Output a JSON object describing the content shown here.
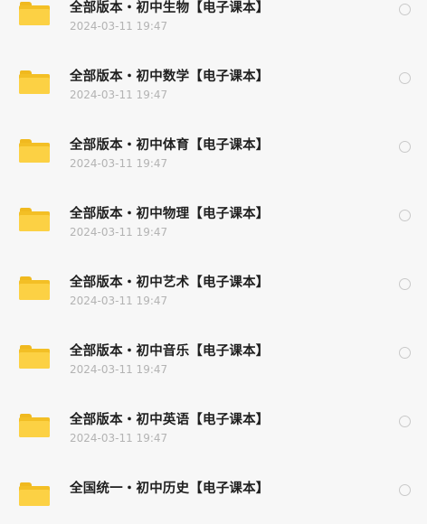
{
  "files": [
    {
      "name": "全部版本・初中生物【电子课本】",
      "date": "2024-03-11 19:47"
    },
    {
      "name": "全部版本・初中数学【电子课本】",
      "date": "2024-03-11 19:47"
    },
    {
      "name": "全部版本・初中体育【电子课本】",
      "date": "2024-03-11 19:47"
    },
    {
      "name": "全部版本・初中物理【电子课本】",
      "date": "2024-03-11 19:47"
    },
    {
      "name": "全部版本・初中艺术【电子课本】",
      "date": "2024-03-11 19:47"
    },
    {
      "name": "全部版本・初中音乐【电子课本】",
      "date": "2024-03-11 19:47"
    },
    {
      "name": "全部版本・初中英语【电子课本】",
      "date": "2024-03-11 19:47"
    },
    {
      "name": "全国统一・初中历史【电子课本】",
      "date": ""
    }
  ],
  "icons": {
    "folder": "folder-icon",
    "select": "radio-unchecked"
  },
  "colors": {
    "background": "#f7f7f7",
    "folder": "#fcd144",
    "title": "#1f1f1f",
    "date": "#b3b3b3",
    "radio_border": "#c9c9c9"
  }
}
